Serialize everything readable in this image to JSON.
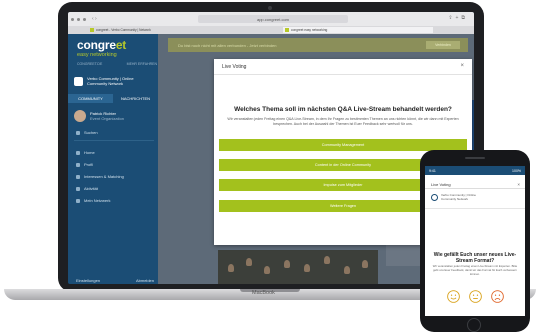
{
  "browser": {
    "url": "app.congreet.com",
    "tabs": [
      {
        "label": "congreet - Verbo Community | Network"
      },
      {
        "label": "congreet easy networking"
      }
    ]
  },
  "sidebar": {
    "logo_main": "congre",
    "logo_accent": "et",
    "tagline": "easy networking",
    "small_left": "CONGREET.DE",
    "small_right": "MEHR ERFAHREN",
    "community_line1": "Verbo Community | Online",
    "community_line2": "Community Network",
    "tabs": [
      "COMMUNITY",
      "NACHRICHTEN"
    ],
    "profile_name": "Patrick Richter",
    "profile_role": "Event Organization",
    "search": "Suchen",
    "items": [
      {
        "label": "Home"
      },
      {
        "label": "Profil"
      },
      {
        "label": "Interessen & Matching"
      },
      {
        "label": "Aktivität"
      },
      {
        "label": "Mein Netzwerk"
      }
    ],
    "footer_left": "Einstellungen",
    "footer_right": "Abmelden"
  },
  "main": {
    "banner_text": "Du bist noch nicht mit allen verbunden - Jetzt verbinden",
    "banner_button": "Verbinden",
    "card_text": "rk"
  },
  "modal": {
    "header": "Live Voting",
    "close": "×",
    "question": "Welches Thema soll im nächsten Q&A Live-Stream behandelt werden?",
    "description": "Wir veranstalten jeden Freitag einen Q&A Live-Stream, in dem Ihr Fragen zu bestimmten Themen an uns richten könnt, die wir dann mit Experten besprechen. Auch bei der Auswahl der Themen ist Euer Feedback sehr wertvoll für uns.",
    "options": [
      {
        "label": "Community Management"
      },
      {
        "label": "Content in der Online Community"
      },
      {
        "label": "Impulse zum Mitglieder"
      },
      {
        "label": "Weitere Fragen"
      }
    ],
    "accent_color": "#a3c11d"
  },
  "laptop": {
    "brand": "MacBook"
  },
  "phone": {
    "time": "9:41",
    "battery": "100%",
    "header": "Live Voting",
    "close": "×",
    "community_line1": "Verbo Community | Online",
    "community_line2": "Community Network",
    "question": "Wie gefällt Euch unser neues Live-Stream Format?",
    "description": "Wir veranstalten jeden Freitag einen Live-Stream mit Experten. Bitte gebt uns Euer Feedback, damit wir das Format für Euch verbessern können.",
    "smileys": [
      "happy-icon",
      "neutral-icon",
      "sad-icon"
    ]
  }
}
